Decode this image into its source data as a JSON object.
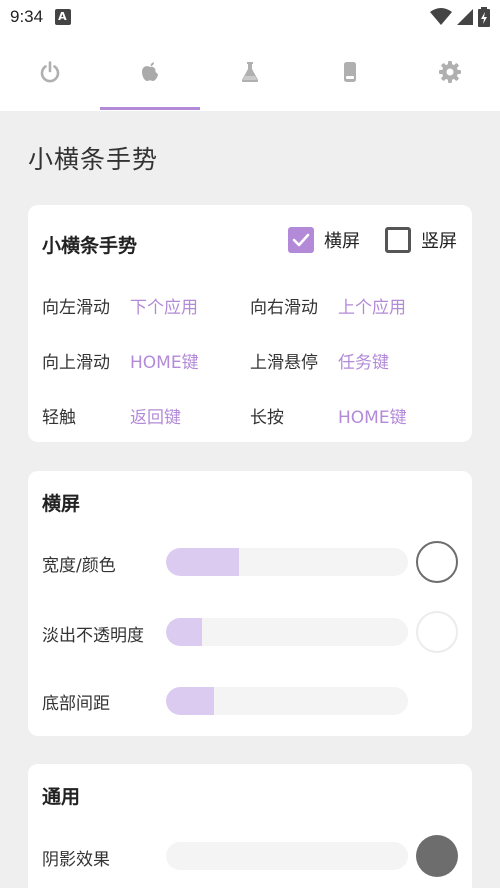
{
  "status_bar": {
    "time": "9:34",
    "notification_icon": "app-notification-icon",
    "icons": [
      "wifi-icon",
      "signal-icon",
      "battery-charging-icon"
    ]
  },
  "tabs": [
    {
      "icon": "power-icon",
      "selected": false
    },
    {
      "icon": "apple-icon",
      "selected": true
    },
    {
      "icon": "flask-icon",
      "selected": false
    },
    {
      "icon": "phone-icon",
      "selected": false
    },
    {
      "icon": "gear-icon",
      "selected": false
    }
  ],
  "colors": {
    "accent": "#b38ad8",
    "accent_light": "#dccbf1",
    "tab_icon": "#b0b0b0",
    "tab_icon_selected": "#aaaaaa",
    "background": "#efefef"
  },
  "page_title": "小横条手势",
  "gesture_card": {
    "title": "小横条手势",
    "landscape": {
      "label": "横屏",
      "checked": true
    },
    "portrait": {
      "label": "竖屏",
      "checked": false
    },
    "gestures": [
      {
        "label": "向左滑动",
        "value": "下个应用"
      },
      {
        "label": "向右滑动",
        "value": "上个应用"
      },
      {
        "label": "向上滑动",
        "value": "HOME键"
      },
      {
        "label": "上滑悬停",
        "value": "任务键"
      },
      {
        "label": "轻触",
        "value": "返回键"
      },
      {
        "label": "长按",
        "value": "HOME键"
      }
    ]
  },
  "landscape_card": {
    "title": "横屏",
    "rows": [
      {
        "label": "宽度/颜色",
        "value": 0.3,
        "swatch": "white-outlined"
      },
      {
        "label": "淡出不透明度",
        "value": 0.15,
        "swatch": "white-faint"
      },
      {
        "label": "底部间距",
        "value": 0.2
      }
    ]
  },
  "general_card": {
    "title": "通用",
    "rows": [
      {
        "label": "阴影效果",
        "value": 0.0,
        "swatch": "dark-gray"
      }
    ]
  }
}
